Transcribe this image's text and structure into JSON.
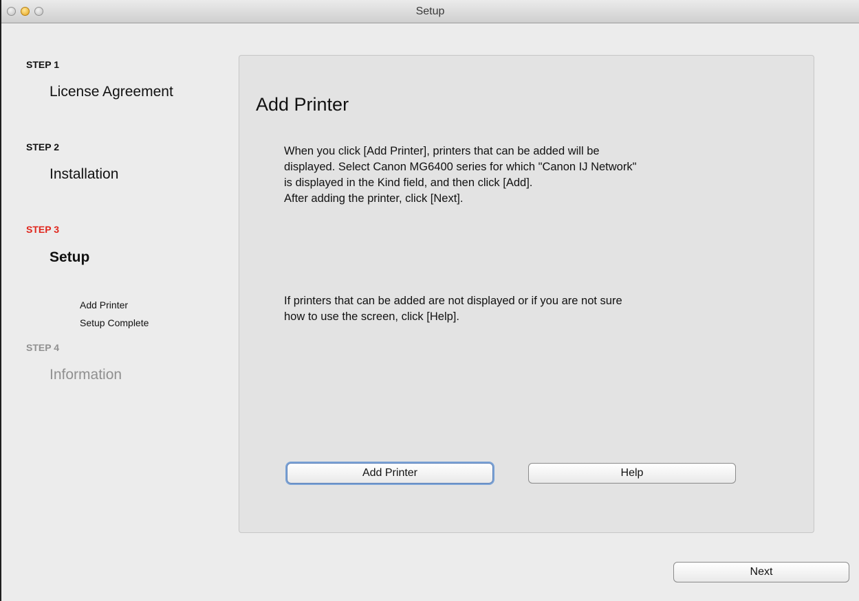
{
  "window": {
    "title": "Setup"
  },
  "sidebar": {
    "steps": [
      {
        "label": "STEP 1",
        "title": "License Agreement"
      },
      {
        "label": "STEP 2",
        "title": "Installation"
      },
      {
        "label": "STEP 3",
        "title": "Setup",
        "substeps": [
          "Add Printer",
          "Setup Complete"
        ]
      },
      {
        "label": "STEP 4",
        "title": "Information"
      }
    ]
  },
  "main": {
    "heading": "Add Printer",
    "paragraph1": [
      "When you click [Add Printer], printers that can be added will be",
      "displayed. Select Canon MG6400 series for which \"Canon IJ Network\"",
      "is displayed in the Kind field, and then click [Add].",
      "After adding the printer, click [Next]."
    ],
    "paragraph2": [
      "If printers that can be added are not displayed or if you are not sure",
      "how to use the screen, click [Help]."
    ],
    "add_printer_button": "Add Printer",
    "help_button": "Help"
  },
  "footer": {
    "next_button": "Next"
  },
  "colors": {
    "active_step": "#e0251b",
    "future_step": "#909090",
    "default_button_ring": "#7ba3d6"
  }
}
